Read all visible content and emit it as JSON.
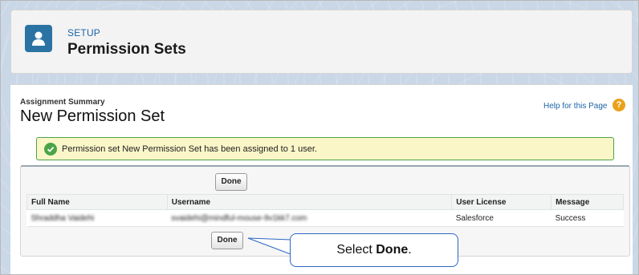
{
  "header": {
    "breadcrumb": "SETUP",
    "title": "Permission Sets"
  },
  "page": {
    "subtitle": "Assignment Summary",
    "title": "New Permission Set",
    "help_link": "Help for this Page",
    "help_icon": "?"
  },
  "success_message": "Permission set New Permission Set has been assigned to 1 user.",
  "buttons": {
    "done_top": "Done",
    "done_bottom": "Done"
  },
  "table": {
    "columns": [
      "Full Name",
      "Username",
      "User License",
      "Message"
    ],
    "rows": [
      {
        "full_name": "Shraddha Vaidehi",
        "username": "svaidehi@mindful-mouse-9v1kk7.com",
        "license": "Salesforce",
        "message": "Success"
      }
    ]
  },
  "callout": {
    "prefix": "Select ",
    "bold": "Done",
    "suffix": "."
  },
  "colors": {
    "brand_blue": "#2a73a2",
    "link_blue": "#1b64a8",
    "success_green": "#4aa547",
    "success_bg": "#fbf6c8",
    "help_orange": "#e8a21b",
    "callout_border": "#2b68c4"
  }
}
